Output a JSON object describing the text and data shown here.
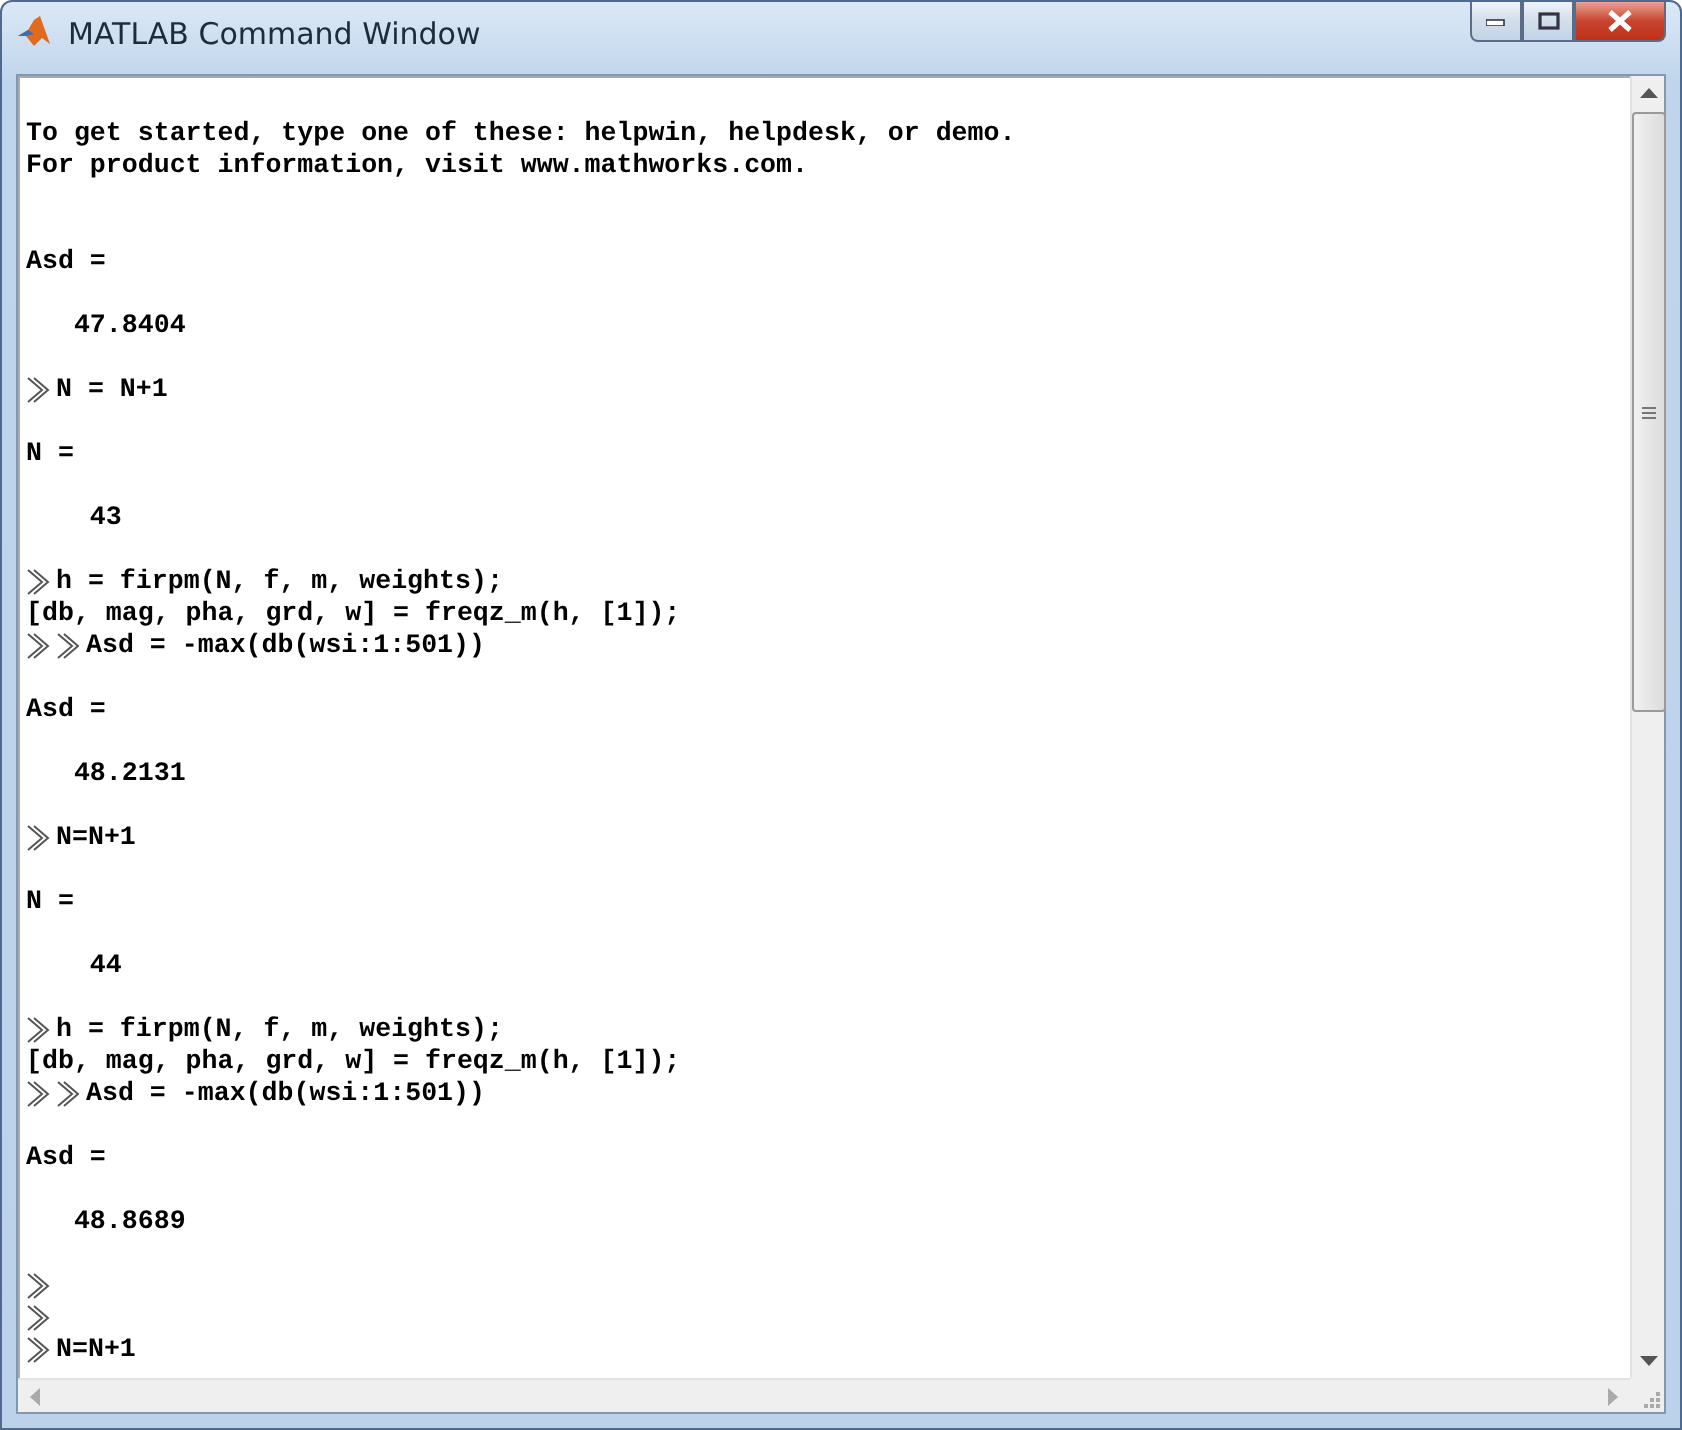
{
  "window": {
    "title": "MATLAB Command Window"
  },
  "console": {
    "lines": [
      {
        "kind": "blank"
      },
      {
        "kind": "output",
        "text": "To get started, type one of these: helpwin, helpdesk, or demo."
      },
      {
        "kind": "output",
        "text": "For product information, visit www.mathworks.com."
      },
      {
        "kind": "blank"
      },
      {
        "kind": "blank"
      },
      {
        "kind": "output",
        "text": "Asd ="
      },
      {
        "kind": "blank"
      },
      {
        "kind": "output",
        "text": "   47.8404"
      },
      {
        "kind": "blank"
      },
      {
        "kind": "command",
        "text": "N = N+1"
      },
      {
        "kind": "blank"
      },
      {
        "kind": "output",
        "text": "N ="
      },
      {
        "kind": "blank"
      },
      {
        "kind": "output",
        "text": "    43"
      },
      {
        "kind": "blank"
      },
      {
        "kind": "command",
        "text": "h = firpm(N, f, m, weights);"
      },
      {
        "kind": "output",
        "text": "[db, mag, pha, grd, w] = freqz_m(h, [1]);"
      },
      {
        "kind": "double_command",
        "text": "Asd = -max(db(wsi:1:501))"
      },
      {
        "kind": "blank"
      },
      {
        "kind": "output",
        "text": "Asd ="
      },
      {
        "kind": "blank"
      },
      {
        "kind": "output",
        "text": "   48.2131"
      },
      {
        "kind": "blank"
      },
      {
        "kind": "command",
        "text": "N=N+1"
      },
      {
        "kind": "blank"
      },
      {
        "kind": "output",
        "text": "N ="
      },
      {
        "kind": "blank"
      },
      {
        "kind": "output",
        "text": "    44"
      },
      {
        "kind": "blank"
      },
      {
        "kind": "command",
        "text": "h = firpm(N, f, m, weights);"
      },
      {
        "kind": "output",
        "text": "[db, mag, pha, grd, w] = freqz_m(h, [1]);"
      },
      {
        "kind": "double_command",
        "text": "Asd = -max(db(wsi:1:501))"
      },
      {
        "kind": "blank"
      },
      {
        "kind": "output",
        "text": "Asd ="
      },
      {
        "kind": "blank"
      },
      {
        "kind": "output",
        "text": "   48.8689"
      },
      {
        "kind": "blank"
      },
      {
        "kind": "prompt"
      },
      {
        "kind": "prompt"
      },
      {
        "kind": "command",
        "text": "N=N+1"
      }
    ]
  }
}
